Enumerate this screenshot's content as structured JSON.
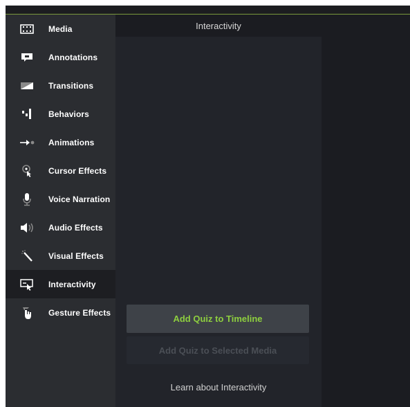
{
  "sidebar": {
    "items": [
      {
        "label": "Media",
        "icon": "film-strip-icon",
        "selected": false
      },
      {
        "label": "Annotations",
        "icon": "callout-icon",
        "selected": false
      },
      {
        "label": "Transitions",
        "icon": "transition-icon",
        "selected": false
      },
      {
        "label": "Behaviors",
        "icon": "behaviors-icon",
        "selected": false
      },
      {
        "label": "Animations",
        "icon": "animation-arrow-icon",
        "selected": false
      },
      {
        "label": "Cursor Effects",
        "icon": "cursor-icon",
        "selected": false
      },
      {
        "label": "Voice Narration",
        "icon": "microphone-icon",
        "selected": false
      },
      {
        "label": "Audio Effects",
        "icon": "speaker-icon",
        "selected": false
      },
      {
        "label": "Visual Effects",
        "icon": "magic-wand-icon",
        "selected": false
      },
      {
        "label": "Interactivity",
        "icon": "interactivity-icon",
        "selected": true
      },
      {
        "label": "Gesture Effects",
        "icon": "hand-gesture-icon",
        "selected": false
      }
    ]
  },
  "panel": {
    "title": "Interactivity",
    "add_quiz_timeline": "Add Quiz to Timeline",
    "add_quiz_selected": "Add Quiz to Selected Media",
    "learn_link": "Learn about Interactivity"
  },
  "colors": {
    "accent_green": "#8ecf3f",
    "selection_bar": "#5fbf3f",
    "sidebar_bg": "#2b2d31",
    "panel_bg": "#22242a"
  }
}
